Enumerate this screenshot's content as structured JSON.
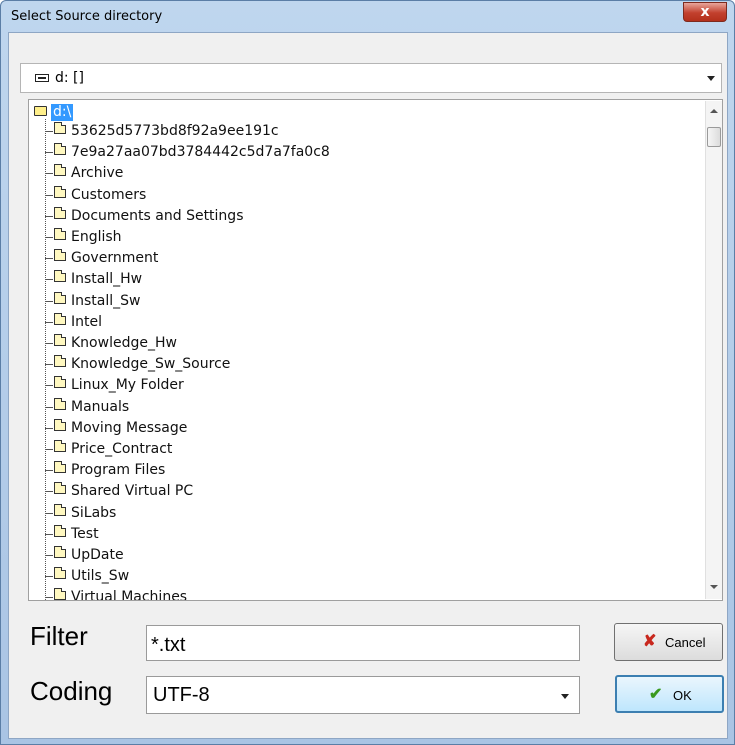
{
  "window": {
    "title": "Select Source directory",
    "close_label": "x"
  },
  "drive": {
    "selected": "d: []"
  },
  "tree": {
    "root": "d:\\",
    "items": [
      "53625d5773bd8f92a9ee191c",
      "7e9a27aa07bd3784442c5d7a7fa0c8",
      "Archive",
      "Customers",
      "Documents and Settings",
      "English",
      "Government",
      "Install_Hw",
      "Install_Sw",
      "Intel",
      "Knowledge_Hw",
      "Knowledge_Sw_Source",
      "Linux_My Folder",
      "Manuals",
      "Moving Message",
      "Price_Contract",
      "Program Files",
      "Shared Virtual PC",
      "SiLabs",
      "Test",
      "UpDate",
      "Utils_Sw",
      "Virtual Machines"
    ]
  },
  "filter": {
    "label": "Filter",
    "value": "*.txt"
  },
  "coding": {
    "label": "Coding",
    "selected": "UTF-8"
  },
  "buttons": {
    "cancel_label": "Cancel",
    "ok_label": "OK"
  },
  "colors": {
    "selection": "#3399ff",
    "cancel_icon": "#c8281e",
    "ok_icon": "#3a9a1f"
  }
}
